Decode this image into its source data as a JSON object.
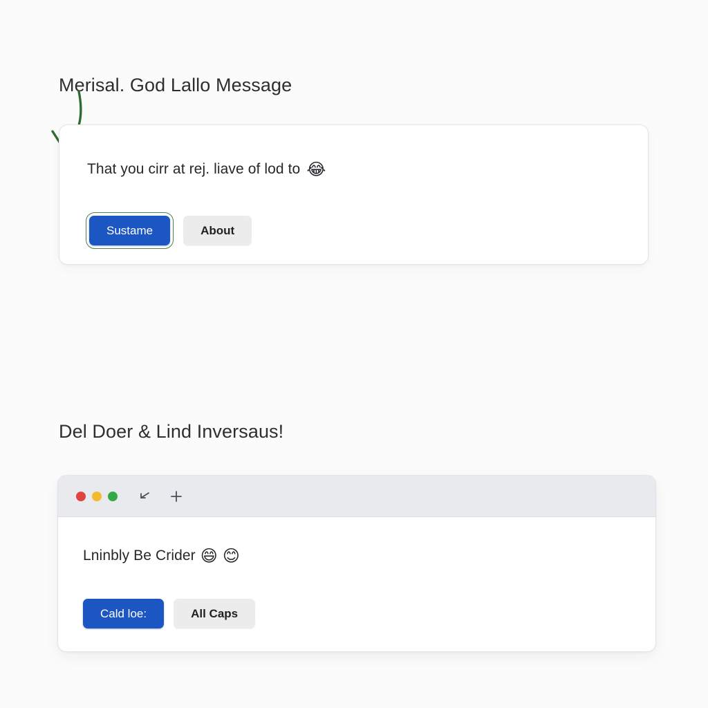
{
  "background_color": "#fbfbfc",
  "accent_color": "#1b56c2",
  "focus_ring_color": "#4a7f4c",
  "annotation": {
    "arrow_color": "#2f6b33",
    "name": "hand-drawn-down-left-arrow"
  },
  "section_one": {
    "heading": "Merisal. God Lallo Message",
    "card": {
      "text": "That you cirr at rej. liave of lod to",
      "emoji": "😂",
      "emoji_name": "face-with-tears-of-joy",
      "buttons": [
        {
          "label": "Sustame",
          "style": "primary",
          "focused": true
        },
        {
          "label": "About",
          "style": "secondary",
          "focused": false
        }
      ]
    }
  },
  "section_two": {
    "heading": "Del Doer & Lind Inversaus!",
    "window": {
      "titlebar": {
        "traffic_lights": [
          {
            "name": "close-button",
            "color": "#e0443e"
          },
          {
            "name": "minimize-button",
            "color": "#f2bb2f"
          },
          {
            "name": "maximize-button",
            "color": "#36a845"
          }
        ],
        "icons": [
          {
            "name": "back-arrow-icon",
            "glyph": "back"
          },
          {
            "name": "plus-icon",
            "glyph": "plus"
          }
        ]
      },
      "body": {
        "text": "Lninbly Be Crider",
        "emoji_one": "😄",
        "emoji_one_name": "grinning-face-with-smiling-eyes",
        "emoji_two": "😊",
        "emoji_two_name": "smiling-face-with-smiling-eyes",
        "buttons": [
          {
            "label": "Cald loe:",
            "style": "primary"
          },
          {
            "label": "All Caps",
            "style": "secondary"
          }
        ]
      }
    }
  }
}
